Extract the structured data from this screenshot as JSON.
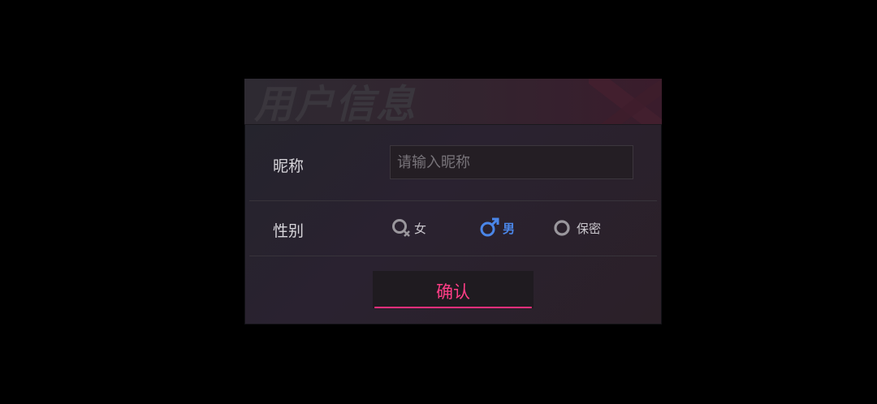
{
  "dialog": {
    "title": "用户信息"
  },
  "nickname": {
    "label": "昵称",
    "value": "",
    "placeholder": "请输入昵称"
  },
  "gender": {
    "label": "性别",
    "selected": "male",
    "options": [
      {
        "key": "female",
        "label": "女",
        "icon": "female-symbol-icon"
      },
      {
        "key": "male",
        "label": "男",
        "icon": "male-symbol-icon"
      },
      {
        "key": "secret",
        "label": "保密",
        "icon": "circle-icon"
      }
    ]
  },
  "confirm": {
    "label": "确认"
  },
  "colors": {
    "accent": "#ff2f7c",
    "selected": "#4a86e8",
    "unselected": "#9a979d"
  }
}
